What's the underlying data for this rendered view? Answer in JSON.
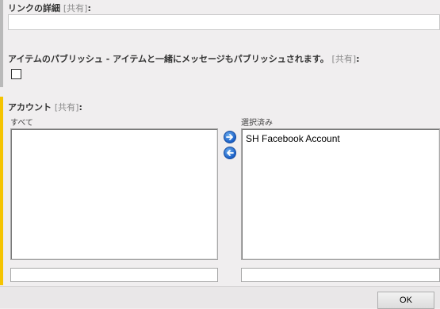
{
  "link_details": {
    "label": "リンクの詳細",
    "shared": "[共有]",
    "colon": ":",
    "value": ""
  },
  "publish_item": {
    "label": "アイテムのパブリッシュ - アイテムと一緒にメッセージもパブリッシュされます。",
    "shared": "[共有]",
    "colon": ":",
    "checked": false
  },
  "account": {
    "label": "アカウント",
    "shared": "[共有]",
    "colon": ":",
    "all_label": "すべて",
    "selected_label": "選択済み",
    "all_items": [],
    "selected_items": [
      "SH Facebook Account"
    ],
    "all_filter": "",
    "selected_filter": "",
    "add_icon": "arrow-right-icon",
    "remove_icon": "arrow-left-icon"
  },
  "footer": {
    "ok_label": "OK"
  },
  "colors": {
    "required_bar": "#f5c400",
    "accent": "#1a5fc6"
  }
}
